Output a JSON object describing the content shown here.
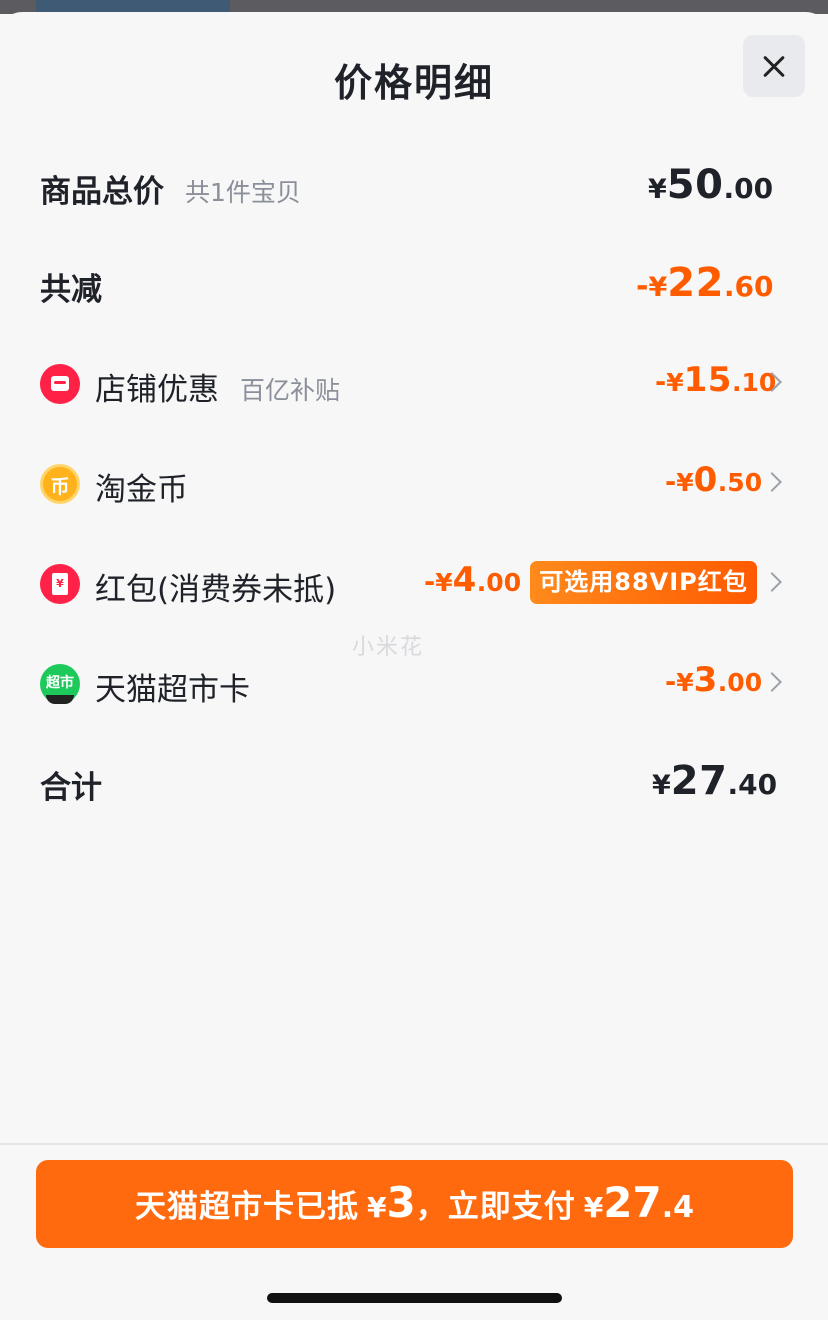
{
  "header": {
    "title": "价格明细",
    "close_label": "×"
  },
  "total": {
    "label": "商品总价",
    "sub": "共1件宝贝",
    "currency": "¥",
    "int": "50",
    "dec": ".00"
  },
  "reduction": {
    "label": "共减",
    "sign": "-",
    "currency": "¥",
    "int": "22",
    "dec": ".60"
  },
  "items": [
    {
      "label": "店铺优惠",
      "sub": "百亿补贴",
      "sign": "-",
      "currency": "¥",
      "int": "15",
      "dec": ".10",
      "icon": "shop-discount-icon"
    },
    {
      "label": "淘金币",
      "sign": "-",
      "currency": "¥",
      "int": "0",
      "dec": ".50",
      "icon": "gold-coin-icon",
      "icon_glyph": "币"
    },
    {
      "label": "红包(消费券未抵)",
      "sign": "-",
      "currency": "¥",
      "int": "4",
      "dec": ".00",
      "icon": "red-packet-icon",
      "icon_glyph": "¥",
      "badge": "可选用88VIP红包"
    },
    {
      "label": "天猫超市卡",
      "sign": "-",
      "currency": "¥",
      "int": "3",
      "dec": ".00",
      "icon": "tmall-supermarket-icon",
      "icon_glyph": "超市"
    }
  ],
  "subtotal": {
    "label": "合计",
    "currency": "¥",
    "int": "27",
    "dec": ".40"
  },
  "watermark": "小米花",
  "pay_button": {
    "text": "天猫超市卡已抵",
    "deduct_currency": "¥",
    "deduct_int": "3",
    "separator": "，立即支付",
    "currency": "¥",
    "int": "27",
    "dec": ".4"
  },
  "colors": {
    "accent": "#ff5c00",
    "button": "#ff6a0f",
    "text": "#1f2329",
    "muted": "#8a8f99"
  }
}
